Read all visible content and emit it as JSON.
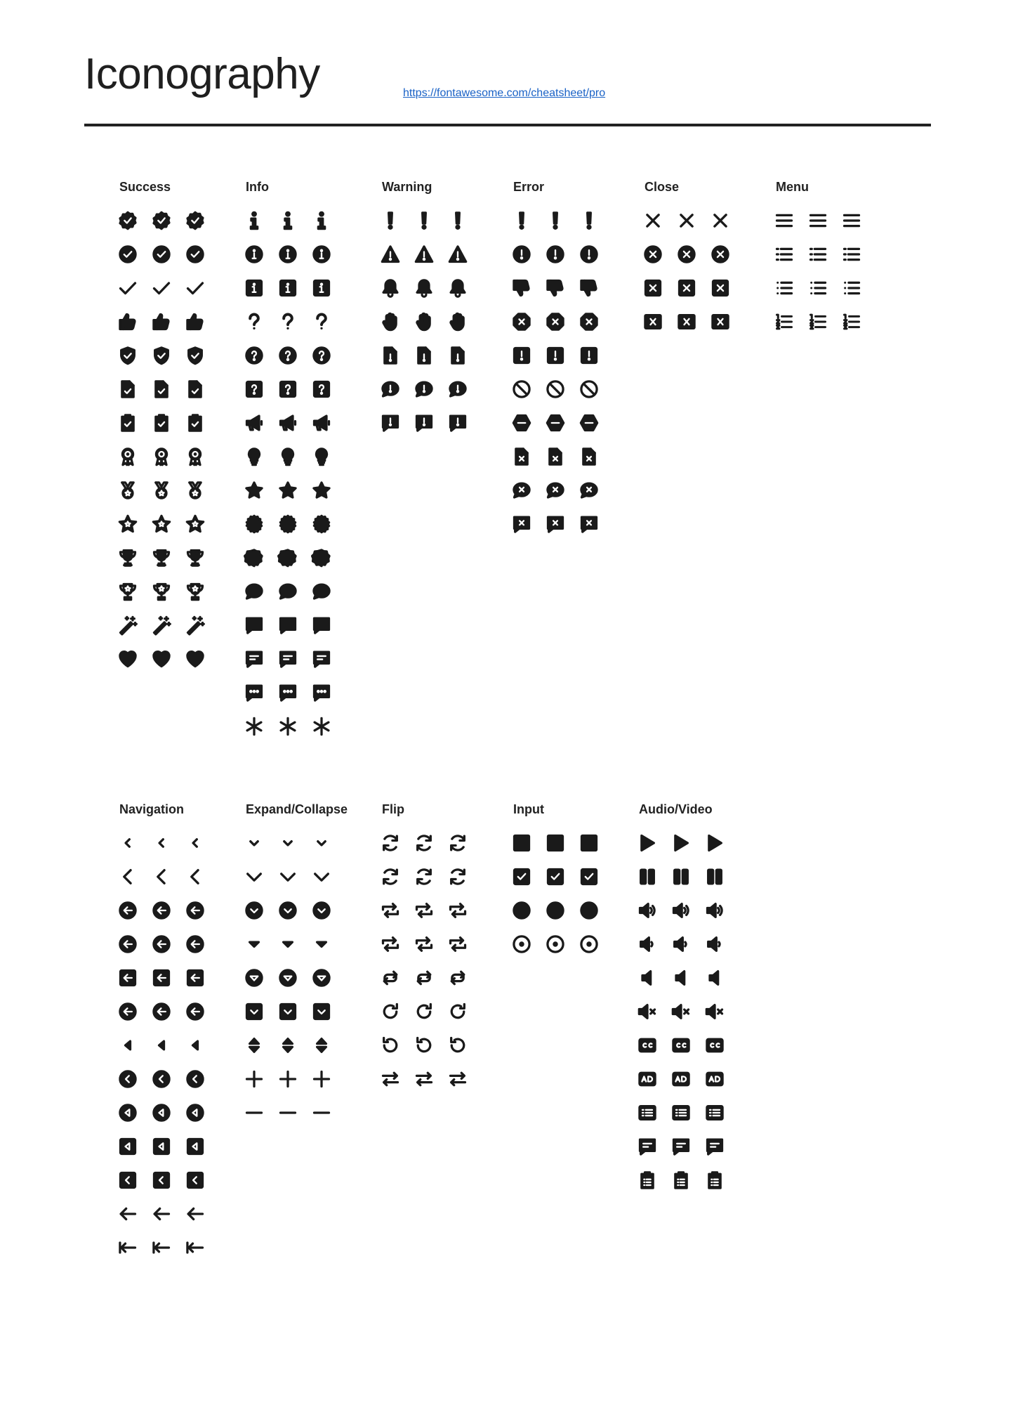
{
  "header": {
    "title": "Iconography",
    "link": "https://fontawesome.com/cheatsheet/pro"
  },
  "groups": [
    {
      "id": "success",
      "title": "Success",
      "icons": [
        "badge-check-icon",
        "circle-check-icon",
        "check-icon",
        "thumbs-up-icon",
        "shield-check-icon",
        "file-check-icon",
        "clipboard-check-icon",
        "award-icon",
        "medal-icon",
        "star-badge-icon",
        "trophy-icon",
        "trophy-star-icon",
        "magic-wand-icon",
        "heart-icon"
      ]
    },
    {
      "id": "info",
      "title": "Info",
      "icons": [
        "info-icon",
        "circle-info-icon",
        "square-info-icon",
        "question-icon",
        "circle-question-icon",
        "square-question-icon",
        "megaphone-icon",
        "lightbulb-icon",
        "star-icon",
        "certificate-icon",
        "badge-icon",
        "comment-icon",
        "message-icon",
        "message-lines-icon",
        "message-dots-icon",
        "asterisk-icon"
      ]
    },
    {
      "id": "warning",
      "title": "Warning",
      "icons": [
        "exclamation-icon",
        "triangle-exclamation-icon",
        "bell-icon",
        "hand-icon",
        "file-exclamation-icon",
        "comment-exclamation-icon",
        "message-exclamation-icon"
      ]
    },
    {
      "id": "error",
      "title": "Error",
      "icons": [
        "exclamation-icon",
        "circle-exclamation-icon",
        "thumbs-down-icon",
        "octagon-xmark-icon",
        "square-exclamation-icon",
        "ban-icon",
        "hexagon-minus-icon",
        "file-xmark-icon",
        "comment-xmark-icon",
        "message-xmark-icon"
      ]
    },
    {
      "id": "close",
      "title": "Close",
      "icons": [
        "xmark-icon",
        "circle-xmark-icon",
        "square-xmark-icon",
        "rect-xmark-icon"
      ]
    },
    {
      "id": "menu",
      "title": "Menu",
      "icons": [
        "bars-icon",
        "list-icon",
        "list-ul-icon",
        "list-ol-icon"
      ]
    },
    {
      "id": "navigation",
      "title": "Navigation",
      "icons": [
        "chevron-left-small-icon",
        "chevron-left-icon",
        "circle-arrow-left-icon",
        "circle-arrow-left-alt-icon",
        "square-arrow-left-icon",
        "circle-arrow-left-2-icon",
        "caret-left-icon",
        "circle-chevron-left-icon",
        "circle-caret-left-icon",
        "square-caret-left-icon",
        "square-chevron-left-icon",
        "arrow-left-icon",
        "arrow-left-to-line-icon"
      ]
    },
    {
      "id": "expand",
      "title": "Expand/Collapse",
      "icons": [
        "chevron-down-small-icon",
        "chevron-down-icon",
        "circle-chevron-down-icon",
        "caret-down-icon",
        "circle-caret-down-icon",
        "square-chevron-down-icon",
        "sort-icon",
        "plus-icon",
        "minus-icon"
      ]
    },
    {
      "id": "flip",
      "title": "Flip",
      "icons": [
        "arrows-rotate-icon",
        "arrows-rotate-alt-icon",
        "repeat-icon",
        "repeat-alt-icon",
        "repeat-loop-icon",
        "rotate-right-icon",
        "rotate-left-icon",
        "arrow-right-arrow-left-icon"
      ]
    },
    {
      "id": "input",
      "title": "Input",
      "icons": [
        "square-icon",
        "square-check-icon",
        "circle-icon",
        "circle-dot-icon"
      ]
    },
    {
      "id": "av",
      "title": "Audio/Video",
      "icons": [
        "play-icon",
        "pause-icon",
        "volume-high-icon",
        "volume-low-icon",
        "volume-off-icon",
        "volume-xmark-icon",
        "closed-captioning-icon",
        "audio-description-icon",
        "rectangle-list-icon",
        "message-lines-icon",
        "clipboard-list-icon"
      ]
    }
  ]
}
